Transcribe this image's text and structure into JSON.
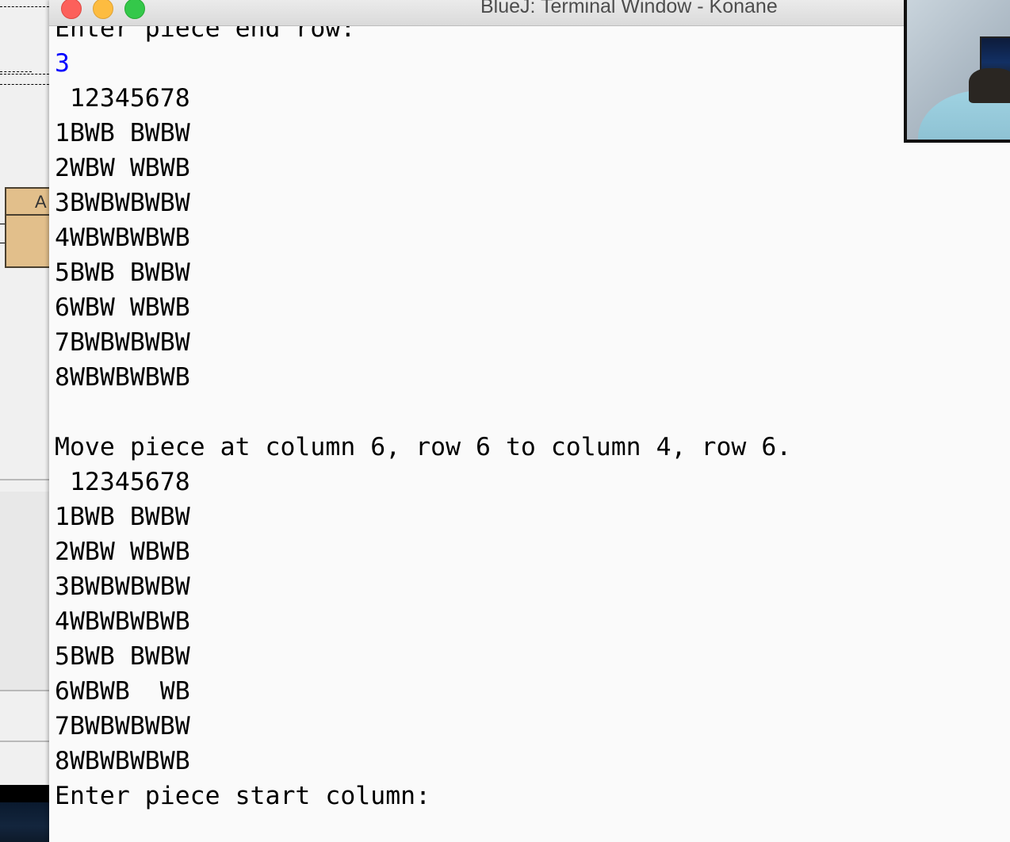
{
  "background_window": {
    "class_box_label": "A"
  },
  "terminal": {
    "title": "BlueJ: Terminal Window - Konane",
    "lines": [
      {
        "text": "Enter piece end row:",
        "kind": "output"
      },
      {
        "text": "3",
        "kind": "input"
      },
      {
        "text": " 12345678",
        "kind": "output"
      },
      {
        "text": "1BWB BWBW",
        "kind": "output"
      },
      {
        "text": "2WBW WBWB",
        "kind": "output"
      },
      {
        "text": "3BWBWBWBW",
        "kind": "output"
      },
      {
        "text": "4WBWBWBWB",
        "kind": "output"
      },
      {
        "text": "5BWB BWBW",
        "kind": "output"
      },
      {
        "text": "6WBW WBWB",
        "kind": "output"
      },
      {
        "text": "7BWBWBWBW",
        "kind": "output"
      },
      {
        "text": "8WBWBWBWB",
        "kind": "output"
      },
      {
        "text": "",
        "kind": "output"
      },
      {
        "text": "Move piece at column 6, row 6 to column 4, row 6.",
        "kind": "output"
      },
      {
        "text": " 12345678",
        "kind": "output"
      },
      {
        "text": "1BWB BWBW",
        "kind": "output"
      },
      {
        "text": "2WBW WBWB",
        "kind": "output"
      },
      {
        "text": "3BWBWBWBW",
        "kind": "output"
      },
      {
        "text": "4WBWBWBWB",
        "kind": "output"
      },
      {
        "text": "5BWB BWBW",
        "kind": "output"
      },
      {
        "text": "6WBWB  WB",
        "kind": "output"
      },
      {
        "text": "7BWBWBWBW",
        "kind": "output"
      },
      {
        "text": "8WBWBWBWB",
        "kind": "output"
      },
      {
        "text": "Enter piece start column:",
        "kind": "output"
      }
    ]
  },
  "colors": {
    "input_text": "#0000ff",
    "output_text": "#000000",
    "terminal_bg": "#fafafa",
    "close_button": "#fc605b",
    "minimize_button": "#fdbc40",
    "maximize_button": "#34c84a"
  }
}
